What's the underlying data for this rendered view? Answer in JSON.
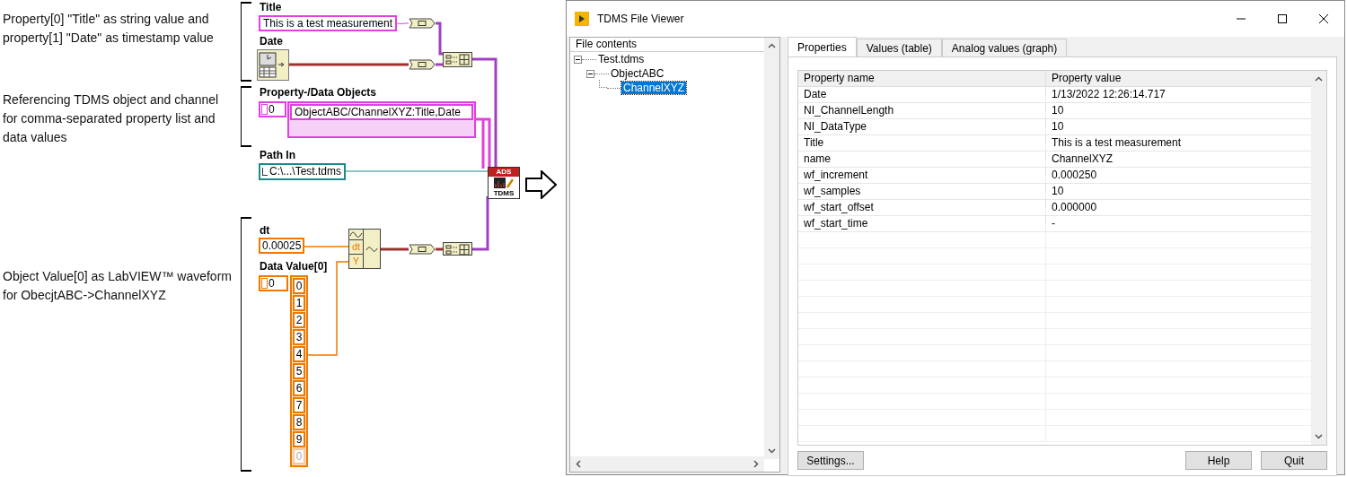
{
  "annotations": [
    {
      "text": "Property[0] \"Title\" as string value and property[1] \"Date\" as timestamp value"
    },
    {
      "text": "Referencing TDMS object and channel for comma-separated property list and data values"
    },
    {
      "text": "Object Value[0] as LabVIEW™ waveform for ObecjtABC->ChannelXYZ"
    }
  ],
  "diagram": {
    "title_label": "Title",
    "title_value": "This is a test measurement",
    "date_label": "Date",
    "objects_label": "Property-/Data Objects",
    "objects_index": "0",
    "objects_value": "ObjectABC/ChannelXYZ:Title,Date",
    "path_label": "Path In",
    "path_value": "C:\\...\\Test.tdms",
    "node_top": "ADS",
    "node_bottom": "TDMS",
    "dt_label": "dt",
    "dt_value": "0.00025",
    "data_label": "Data Value[0]",
    "data_index": "0",
    "build_inputs": [
      "dt",
      "Y"
    ],
    "data_values": [
      {
        "text": "0",
        "disabled": false
      },
      {
        "text": "1",
        "disabled": false
      },
      {
        "text": "2",
        "disabled": false
      },
      {
        "text": "3",
        "disabled": false
      },
      {
        "text": "4",
        "disabled": false
      },
      {
        "text": "5",
        "disabled": false
      },
      {
        "text": "6",
        "disabled": false
      },
      {
        "text": "7",
        "disabled": false
      },
      {
        "text": "8",
        "disabled": false
      },
      {
        "text": "9",
        "disabled": false
      },
      {
        "text": "0",
        "disabled": true
      }
    ]
  },
  "viewer": {
    "title": "TDMS File Viewer",
    "tree_header": "File contents",
    "tree": [
      {
        "label": "Test.tdms",
        "expanded": true,
        "selected": false,
        "children": [
          {
            "label": "ObjectABC",
            "expanded": true,
            "selected": false,
            "children": [
              {
                "label": "ChannelXYZ",
                "selected": true
              }
            ]
          }
        ]
      }
    ],
    "tabs": [
      {
        "label": "Properties",
        "selected": true
      },
      {
        "label": "Values (table)",
        "selected": false
      },
      {
        "label": "Analog values (graph)",
        "selected": false
      }
    ],
    "table": {
      "columns": [
        "Property name",
        "Property value"
      ],
      "rows": [
        [
          "Date",
          "1/13/2022 12:26:14.717"
        ],
        [
          "NI_ChannelLength",
          "10"
        ],
        [
          "NI_DataType",
          "10"
        ],
        [
          "Title",
          "This is a test measurement"
        ],
        [
          "name",
          "ChannelXYZ"
        ],
        [
          "wf_increment",
          "0.000250"
        ],
        [
          "wf_samples",
          "10"
        ],
        [
          "wf_start_offset",
          "0.000000"
        ],
        [
          "wf_start_time",
          "-"
        ]
      ]
    },
    "buttons": [
      {
        "label": "Settings..."
      },
      {
        "label": "Help"
      },
      {
        "label": "Quit"
      }
    ]
  }
}
